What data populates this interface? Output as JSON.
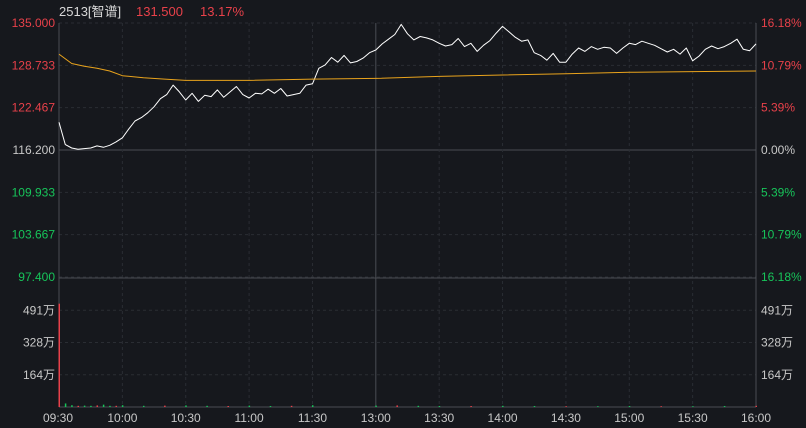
{
  "header": {
    "code_name": "2513[智谱]",
    "price": "131.500",
    "pct": "13.17%"
  },
  "colors": {
    "background": "#16181d",
    "up": "#e8414a",
    "down": "#17c45a",
    "neutral": "#c8c8c8",
    "price_line": "#ffffff",
    "avg_line": "#e9a31c",
    "grid": "#2a2d33",
    "solid_grid": "#4a4d53"
  },
  "chart_data": {
    "type": "line",
    "title": "2513[智谱]",
    "prev_close": 116.2,
    "ylim": [
      97.4,
      135.0
    ],
    "price_ticks_left": [
      "135.000",
      "128.733",
      "122.467",
      "116.200",
      "109.933",
      "103.667",
      "97.400"
    ],
    "pct_ticks_right": [
      "16.18%",
      "10.79%",
      "5.39%",
      "0.00%",
      "5.39%",
      "10.79%",
      "16.18%"
    ],
    "volume_ticks": [
      "491万",
      "328万",
      "164万"
    ],
    "time_ticks": [
      "09:30",
      "10:00",
      "10:30",
      "11:00",
      "11:30",
      "13:00",
      "13:30",
      "14:00",
      "14:30",
      "15:00",
      "15:30",
      "16:00"
    ],
    "series": [
      {
        "x": [
          "09:30",
          "09:33",
          "09:36",
          "09:39",
          "09:42",
          "09:45",
          "09:48",
          "09:51",
          "09:54",
          "09:57",
          "10:00",
          "10:03",
          "10:06",
          "10:09",
          "10:12",
          "10:15",
          "10:18",
          "10:21",
          "10:24",
          "10:27",
          "10:30",
          "10:33",
          "10:36",
          "10:39",
          "10:42",
          "10:45",
          "10:48",
          "10:51",
          "10:54",
          "10:57",
          "11:00",
          "11:03",
          "11:06",
          "11:09",
          "11:12",
          "11:15",
          "11:18",
          "11:21",
          "11:24",
          "11:27",
          "11:30",
          "11:33",
          "11:36",
          "11:39",
          "11:42",
          "11:45",
          "11:48",
          "11:51",
          "11:54",
          "11:57",
          "12:00",
          "13:03",
          "13:06",
          "13:09",
          "13:12",
          "13:15",
          "13:18",
          "13:21",
          "13:24",
          "13:27",
          "13:30",
          "13:33",
          "13:36",
          "13:39",
          "13:42",
          "13:45",
          "13:48",
          "13:51",
          "13:54",
          "13:57",
          "14:00",
          "14:03",
          "14:06",
          "14:09",
          "14:12",
          "14:15",
          "14:18",
          "14:21",
          "14:24",
          "14:27",
          "14:30",
          "14:33",
          "14:36",
          "14:39",
          "14:42",
          "14:45",
          "14:48",
          "14:51",
          "14:54",
          "14:57",
          "15:00",
          "15:03",
          "15:06",
          "15:09",
          "15:12",
          "15:15",
          "15:18",
          "15:21",
          "15:24",
          "15:27",
          "15:30",
          "15:33",
          "15:36",
          "15:39",
          "15:42",
          "15:45",
          "15:48",
          "15:51",
          "15:54",
          "15:57",
          "16:00"
        ],
        "values": [
          120.3,
          117.0,
          116.5,
          116.3,
          116.4,
          116.5,
          116.8,
          116.6,
          116.9,
          117.4,
          118.0,
          119.3,
          120.5,
          121.0,
          121.7,
          122.6,
          123.8,
          124.4,
          125.8,
          124.8,
          123.6,
          124.6,
          123.4,
          124.3,
          124.1,
          125.1,
          124.0,
          124.8,
          125.6,
          124.4,
          123.9,
          124.6,
          124.5,
          125.2,
          124.6,
          125.3,
          124.2,
          124.4,
          124.6,
          125.8,
          126.0,
          128.3,
          128.8,
          129.9,
          129.2,
          130.2,
          129.1,
          129.3,
          129.8,
          130.6,
          131.0,
          131.9,
          132.6,
          133.3,
          134.8,
          133.4,
          132.5,
          133.0,
          132.8,
          132.5,
          132.0,
          131.6,
          131.8,
          132.7,
          131.5,
          132.0,
          130.8,
          131.7,
          132.4,
          133.5,
          134.5,
          133.7,
          132.9,
          132.3,
          132.5,
          130.6,
          130.2,
          129.5,
          130.5,
          129.2,
          129.2,
          130.4,
          131.3,
          130.8,
          131.5,
          131.1,
          131.4,
          131.3,
          130.5,
          131.3,
          132.0,
          131.8,
          132.3,
          132.0,
          131.7,
          131.2,
          130.7,
          131.1,
          130.4,
          131.3,
          129.4,
          130.1,
          131.1,
          131.6,
          131.2,
          131.5,
          132.0,
          132.6,
          131.1,
          130.9,
          131.9
        ]
      },
      {
        "x": [
          "09:30",
          "09:36",
          "09:42",
          "09:48",
          "09:54",
          "10:00",
          "10:10",
          "10:20",
          "10:30",
          "11:00",
          "11:30",
          "12:00",
          "13:30",
          "14:00",
          "14:30",
          "15:00",
          "15:30",
          "16:00"
        ],
        "values": [
          130.4,
          129.0,
          128.6,
          128.3,
          127.9,
          127.2,
          126.9,
          126.7,
          126.5,
          126.5,
          126.7,
          126.8,
          127.1,
          127.3,
          127.5,
          127.7,
          127.8,
          127.9
        ]
      }
    ],
    "volume": {
      "x": [
        "09:30",
        "09:33",
        "09:36",
        "09:39",
        "09:42",
        "09:45",
        "09:48",
        "09:51",
        "09:54",
        "09:57",
        "10:00",
        "10:10",
        "10:20",
        "10:30",
        "10:40",
        "10:50",
        "11:00",
        "11:10",
        "11:20",
        "11:30",
        "13:00",
        "13:10",
        "13:20",
        "13:30",
        "13:45",
        "14:00",
        "14:15",
        "14:30",
        "14:45",
        "15:00",
        "15:15",
        "15:30",
        "15:45",
        "16:00"
      ],
      "values": [
        5250000,
        180000,
        90000,
        60000,
        70000,
        60000,
        80000,
        120000,
        60000,
        60000,
        90000,
        60000,
        70000,
        80000,
        60000,
        50000,
        70000,
        50000,
        60000,
        90000,
        70000,
        80000,
        60000,
        50000,
        50000,
        60000,
        50000,
        40000,
        40000,
        50000,
        40000,
        40000,
        50000,
        60000
      ]
    }
  }
}
